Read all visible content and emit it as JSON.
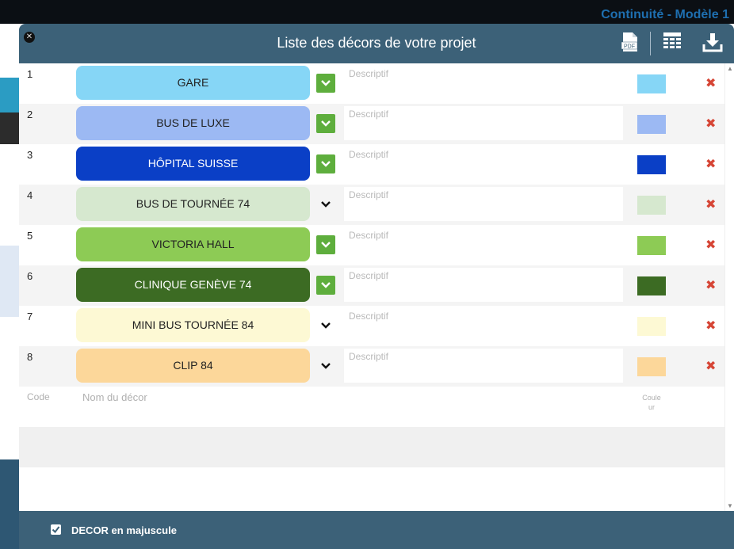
{
  "background": {
    "title": "Continuité - Modèle 1"
  },
  "modal": {
    "title": "Liste des décors de votre projet",
    "pdf_icon_label": "PDF"
  },
  "rows": [
    {
      "code": "1",
      "name": "GARE",
      "color": "#86d6f6",
      "toggle_active": true,
      "desc_placeholder": "Descriptif"
    },
    {
      "code": "2",
      "name": "BUS DE LUXE",
      "color": "#9cb9f3",
      "toggle_active": true,
      "desc_placeholder": "Descriptif"
    },
    {
      "code": "3",
      "name": "HÔPITAL SUISSE",
      "color": "#0a3fc6",
      "toggle_active": true,
      "desc_placeholder": "Descriptif"
    },
    {
      "code": "4",
      "name": "BUS DE TOURNÉE 74",
      "color": "#d6e8cf",
      "toggle_active": false,
      "desc_placeholder": "Descriptif"
    },
    {
      "code": "5",
      "name": "VICTORIA HALL",
      "color": "#8dcb55",
      "toggle_active": true,
      "desc_placeholder": "Descriptif"
    },
    {
      "code": "6",
      "name": "CLINIQUE GENÈVE 74",
      "color": "#3c6b23",
      "toggle_active": true,
      "desc_placeholder": "Descriptif"
    },
    {
      "code": "7",
      "name": "MINI BUS TOURNÉE 84",
      "color": "#fdf9d4",
      "toggle_active": false,
      "desc_placeholder": "Descriptif"
    },
    {
      "code": "8",
      "name": "CLIP 84",
      "color": "#fcd79a",
      "toggle_active": false,
      "desc_placeholder": "Descriptif"
    }
  ],
  "new_row": {
    "code_placeholder": "Code",
    "name_placeholder": "Nom du décor",
    "color_label_line1": "Coule",
    "color_label_line2": "ur"
  },
  "footer": {
    "checkbox_checked": true,
    "checkbox_label": "DECOR en majuscule"
  },
  "colors": {
    "header": "#3c6178",
    "toggle_green": "#5eae3d",
    "delete_red": "#d64535"
  },
  "icons": [
    "close-icon",
    "pdf-icon",
    "table-icon",
    "download-icon",
    "chevron-down-icon",
    "delete-icon",
    "checkbox-icon"
  ]
}
